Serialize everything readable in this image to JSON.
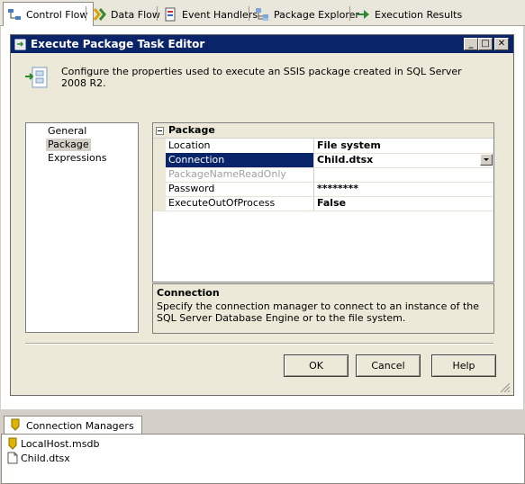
{
  "tabs": [
    {
      "label": "Control Flow",
      "icon": "control-flow-icon",
      "active": true
    },
    {
      "label": "Data Flow",
      "icon": "data-flow-icon"
    },
    {
      "label": "Event Handlers",
      "icon": "event-handlers-icon"
    },
    {
      "label": "Package Explorer",
      "icon": "package-explorer-icon"
    },
    {
      "label": "Execution Results",
      "icon": "execution-results-icon"
    }
  ],
  "dialog": {
    "title": "Execute Package Task Editor",
    "description": "Configure the properties used to execute an SSIS package created in SQL Server 2008 R2.",
    "nav": [
      "General",
      "Package",
      "Expressions"
    ],
    "nav_selected": "Package",
    "category": "Package",
    "properties": [
      {
        "name": "Location",
        "value": "File system"
      },
      {
        "name": "Connection",
        "value": "Child.dtsx",
        "selected": true,
        "dropdown": true
      },
      {
        "name": "PackageNameReadOnly",
        "value": "",
        "disabled": true
      },
      {
        "name": "Password",
        "value": "********"
      },
      {
        "name": "ExecuteOutOfProcess",
        "value": "False"
      }
    ],
    "help_title": "Connection",
    "help_text": "Specify the connection manager to connect to an instance of the SQL Server Database Engine or to the file system.",
    "buttons": {
      "ok": "OK",
      "cancel": "Cancel",
      "help": "Help"
    }
  },
  "connection_managers": {
    "tab_label": "Connection Managers",
    "items": [
      {
        "label": "LocalHost.msdb",
        "icon": "database-connection-icon"
      },
      {
        "label": "Child.dtsx",
        "icon": "file-connection-icon"
      }
    ]
  },
  "colors": {
    "titlebar": "#0a246a",
    "selection": "#0a246a",
    "dialog_bg": "#ece9d8"
  }
}
